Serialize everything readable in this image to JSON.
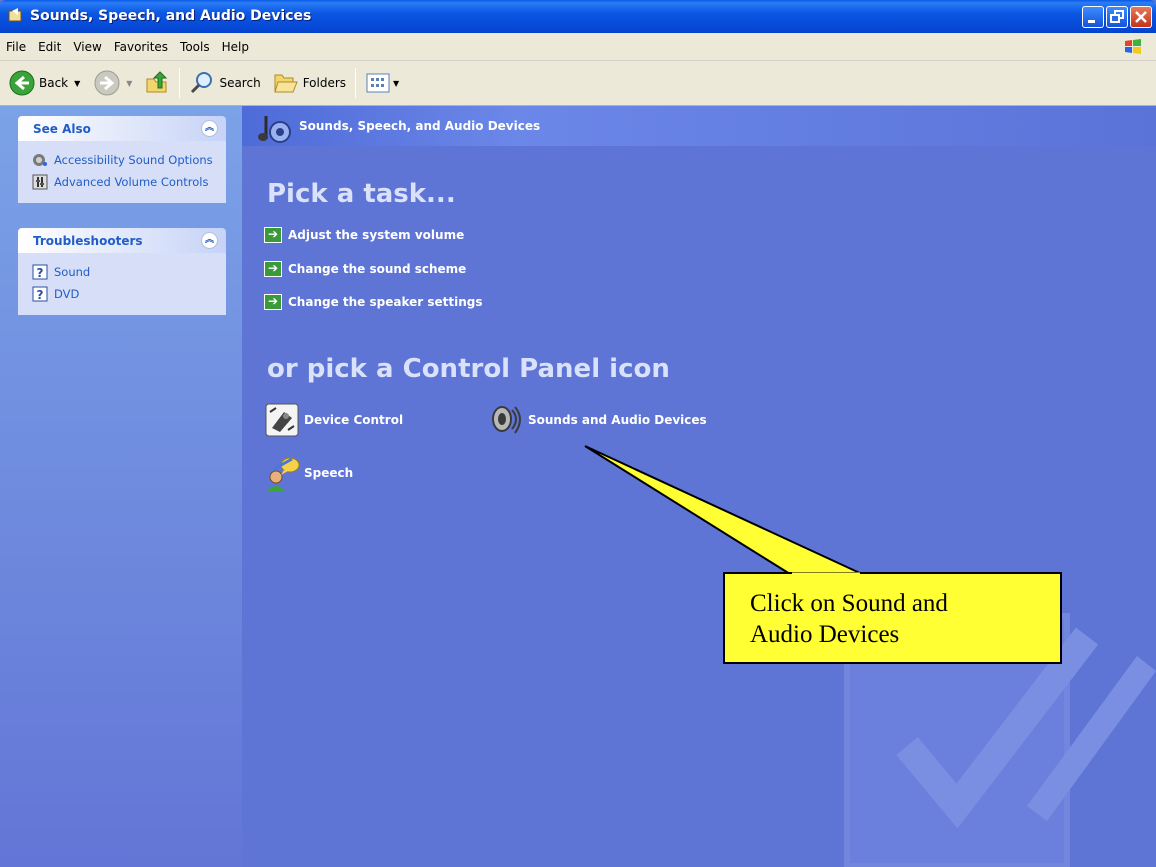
{
  "window": {
    "title": "Sounds, Speech, and Audio Devices"
  },
  "menu": [
    "File",
    "Edit",
    "View",
    "Favorites",
    "Tools",
    "Help"
  ],
  "toolbar": {
    "back_label": "Back",
    "search_label": "Search",
    "folders_label": "Folders"
  },
  "sidebar": {
    "see_also": {
      "title": "See Also",
      "items": [
        {
          "label": "Accessibility Sound Options",
          "icon": "accessibility-icon"
        },
        {
          "label": "Advanced Volume Controls",
          "icon": "volume-control-icon"
        }
      ]
    },
    "troubleshooters": {
      "title": "Troubleshooters",
      "items": [
        {
          "label": "Sound",
          "icon": "help-icon"
        },
        {
          "label": "DVD",
          "icon": "help-icon"
        }
      ]
    }
  },
  "main": {
    "header_title": "Sounds, Speech, and Audio Devices",
    "pick_task": "Pick a task...",
    "tasks": [
      "Adjust the system volume",
      "Change the sound scheme",
      "Change the speaker settings"
    ],
    "pick_icon": "or pick a Control Panel icon",
    "icons": [
      {
        "label": "Device Control",
        "icon": "device-control-icon"
      },
      {
        "label": "Sounds and Audio Devices",
        "icon": "speaker-icon"
      },
      {
        "label": "Speech",
        "icon": "speech-icon"
      }
    ]
  },
  "callout": {
    "line1": "Click on Sound and",
    "line2": "Audio Devices"
  },
  "colors": {
    "callout": "#ffff33",
    "panel": "#5e75d6",
    "titlebar": "#0b57e3"
  }
}
